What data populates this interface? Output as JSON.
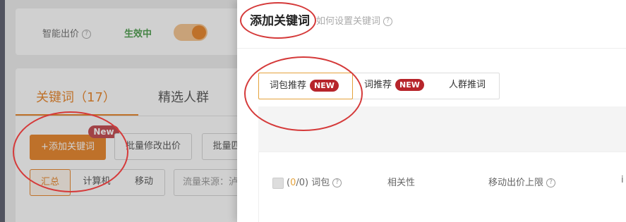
{
  "background_page": {
    "smart_bid": {
      "label": "智能出价",
      "status": "生效中"
    },
    "tabs": [
      {
        "label": "关键词（17）"
      },
      {
        "label": "精选人群"
      }
    ],
    "add_keyword_button": "+添加关键词",
    "new_badge": "New",
    "batch_buttons": [
      {
        "label": "批量修改出价"
      },
      {
        "label": "批量匹"
      }
    ],
    "segments": [
      {
        "label": "汇总"
      },
      {
        "label": "计算机"
      },
      {
        "label": "移动"
      }
    ],
    "traffic_source": "流量来源：泸"
  },
  "drawer": {
    "title": "添加关键词",
    "help_link": "如何设置关键词",
    "tabs": [
      {
        "label": "词包推荐",
        "badge": "NEW"
      },
      {
        "label": "词推荐",
        "badge": "NEW"
      },
      {
        "label": "人群推词"
      }
    ],
    "table": {
      "selected_count": "0",
      "total_count": "0",
      "col_wordpack": "词包",
      "col_relevance": "相关性",
      "col_mobile_bid": "移动出价上限",
      "col_extra": "i"
    }
  },
  "colors": {
    "accent": "#e46e00",
    "badge_red": "#b7252b",
    "annotation_red": "#d53a3a"
  }
}
